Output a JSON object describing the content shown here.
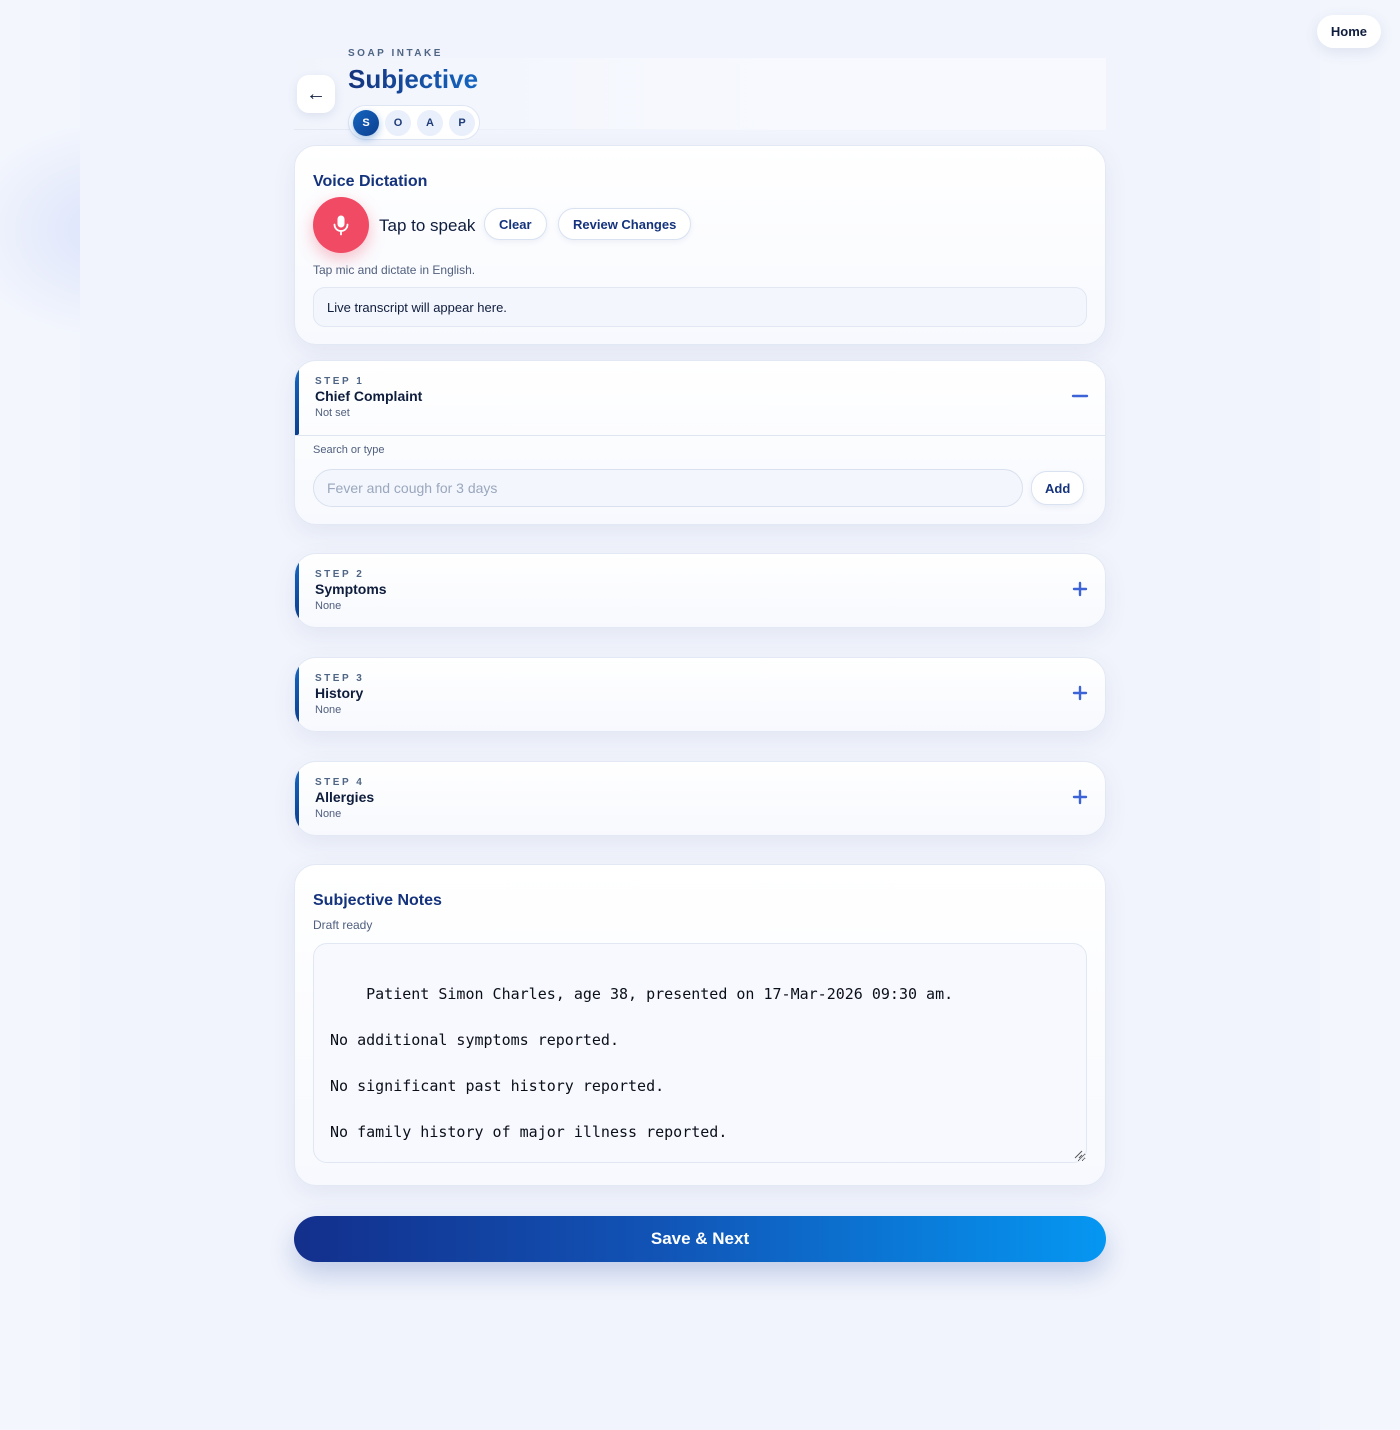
{
  "nav": {
    "home_label": "Home",
    "back_glyph": "←"
  },
  "header": {
    "eyebrow": "SOAP INTAKE",
    "title": "Subjective"
  },
  "soap_steps": [
    {
      "label": "S",
      "active": true
    },
    {
      "label": "O",
      "active": false
    },
    {
      "label": "A",
      "active": false
    },
    {
      "label": "P",
      "active": false
    }
  ],
  "voice": {
    "title": "Voice Dictation",
    "mic_icon": "microphone-icon",
    "tap_label": "Tap to speak",
    "clear_label": "Clear",
    "review_label": "Review Changes",
    "hint": "Tap mic and dictate in English.",
    "transcript": "Live transcript will appear here."
  },
  "steps": [
    {
      "kicker": "STEP 1",
      "title": "Chief Complaint",
      "status": "Not set",
      "expanded": true,
      "toggle_icon": "minus-icon"
    },
    {
      "kicker": "STEP 2",
      "title": "Symptoms",
      "status": "None",
      "expanded": false,
      "toggle_icon": "plus-icon"
    },
    {
      "kicker": "STEP 3",
      "title": "History",
      "status": "None",
      "expanded": false,
      "toggle_icon": "plus-icon"
    },
    {
      "kicker": "STEP 4",
      "title": "Allergies",
      "status": "None",
      "expanded": false,
      "toggle_icon": "plus-icon"
    }
  ],
  "chief_complaint": {
    "search_label": "Search or type",
    "placeholder": "Fever and cough for 3 days",
    "value": "",
    "add_label": "Add"
  },
  "notes": {
    "title": "Subjective Notes",
    "status": "Draft ready",
    "text": "Patient Simon Charles, age 38, presented on 17-Mar-2026 09:30 am.\n\nNo additional symptoms reported.\n\nNo significant past history reported.\n\nNo family history of major illness reported.\n\nNo allergies reported."
  },
  "footer": {
    "save_label": "Save & Next"
  },
  "colors": {
    "accent": "#1565c0",
    "brand_dark": "#15337d",
    "mic": "#f04a64",
    "toggle": "#3d63d8",
    "page_bg": "#f3f6fd"
  }
}
